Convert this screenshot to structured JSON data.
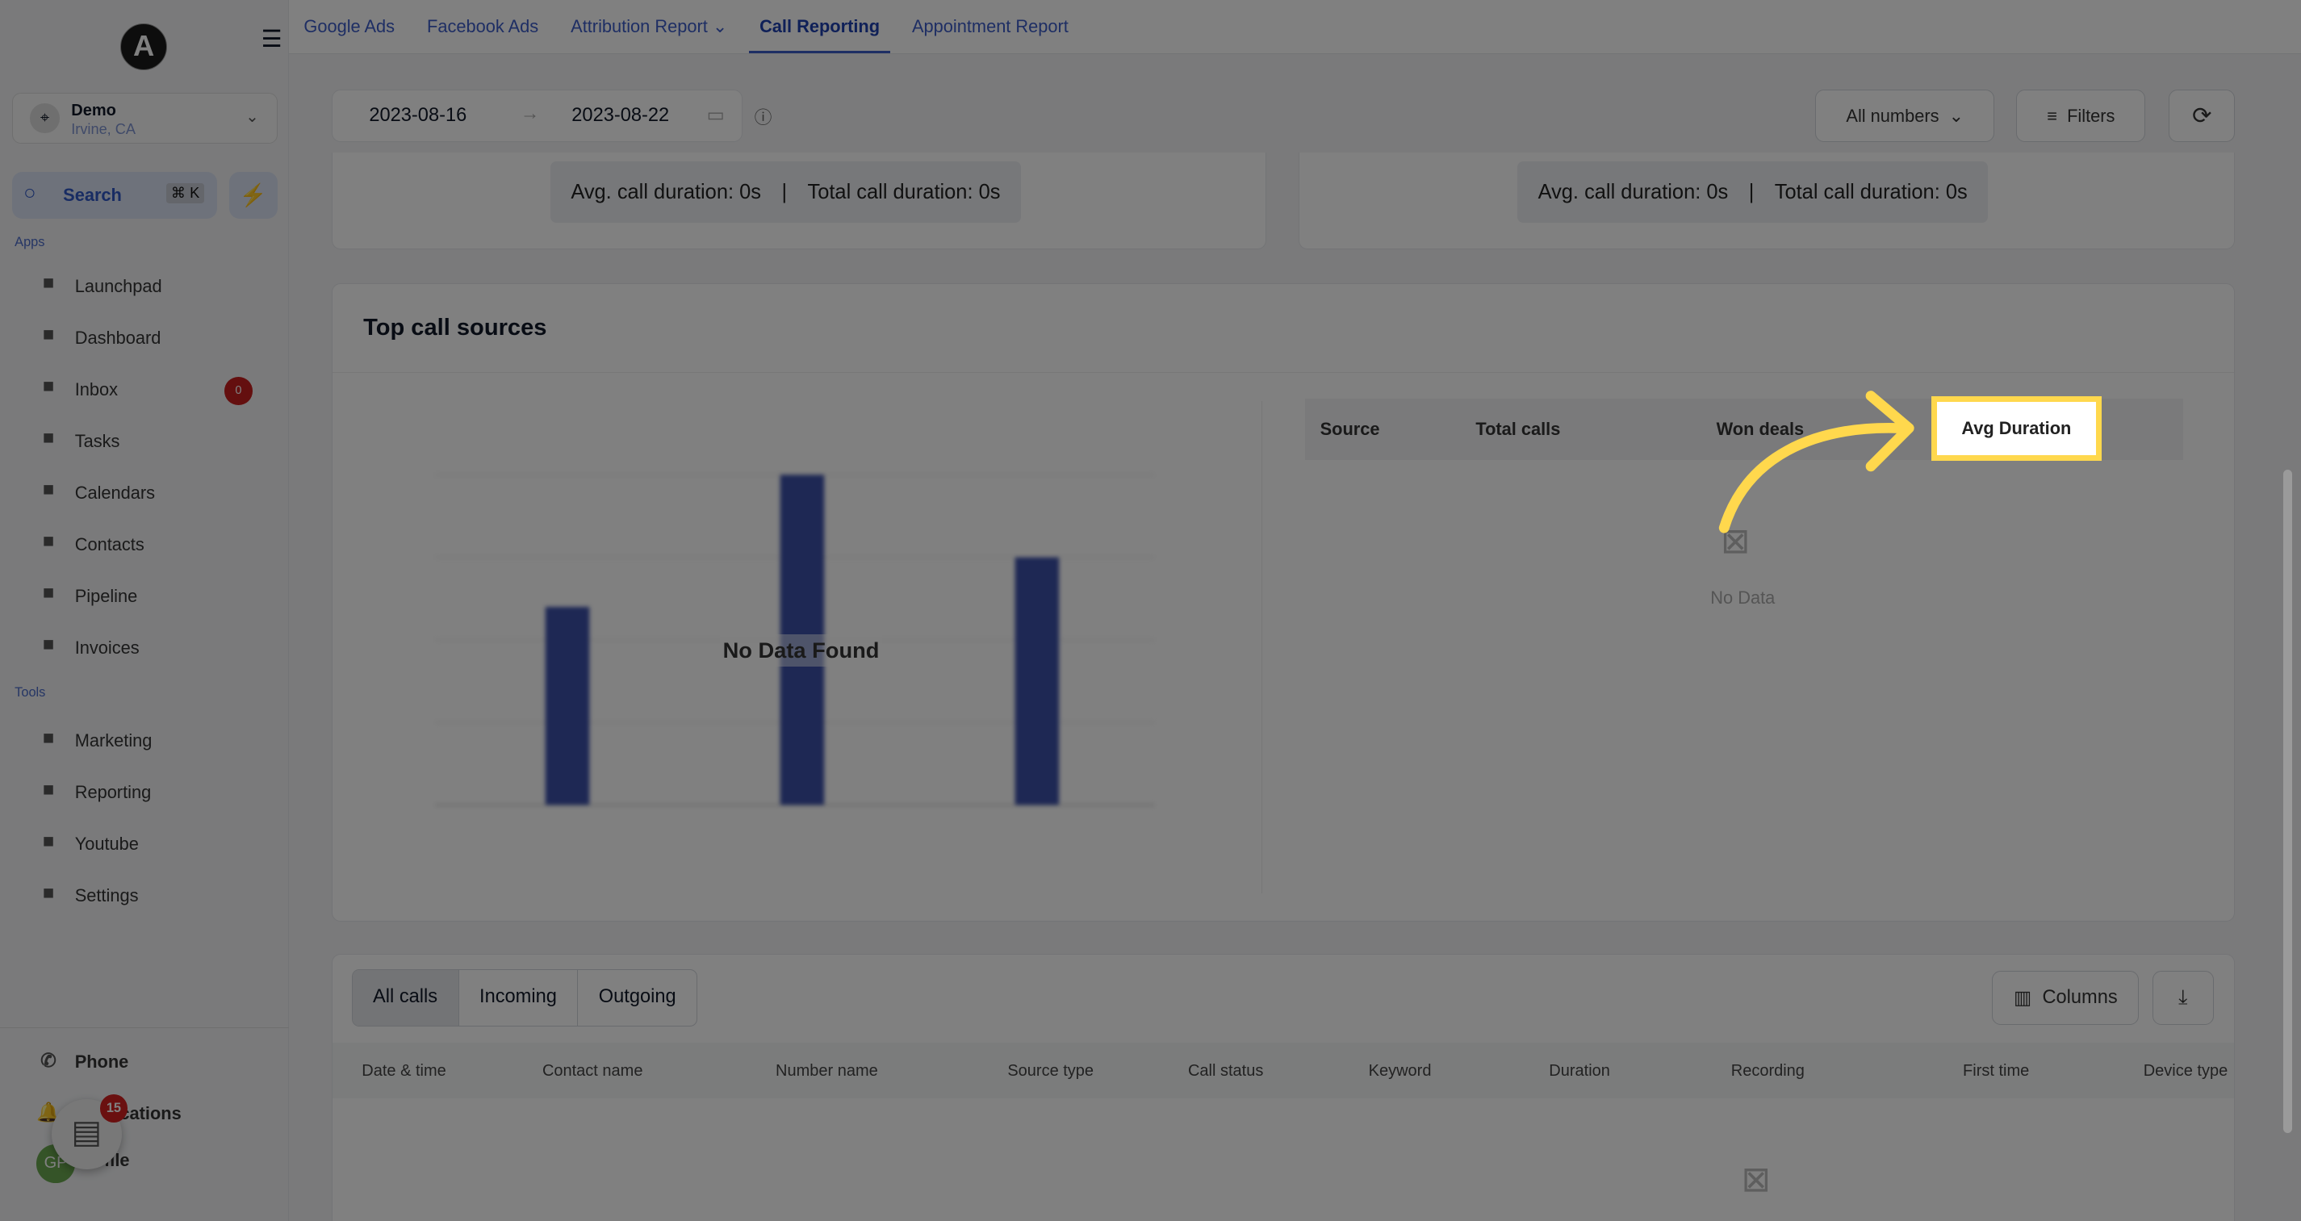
{
  "sidebar": {
    "logo_letter": "A",
    "location": {
      "name": "Demo",
      "city": "Irvine, CA"
    },
    "search": {
      "label": "Search",
      "shortcut": "⌘ K"
    },
    "apps_label": "Apps",
    "tools_label": "Tools",
    "apps": [
      {
        "label": "Launchpad",
        "icon": "rocket-icon"
      },
      {
        "label": "Dashboard",
        "icon": "grid-icon"
      },
      {
        "label": "Inbox",
        "icon": "inbox-icon",
        "badge": "0"
      },
      {
        "label": "Tasks",
        "icon": "clipboard-icon"
      },
      {
        "label": "Calendars",
        "icon": "calendar-icon"
      },
      {
        "label": "Contacts",
        "icon": "person-icon"
      },
      {
        "label": "Pipeline",
        "icon": "filter-icon"
      },
      {
        "label": "Invoices",
        "icon": "invoice-icon"
      }
    ],
    "tools": [
      {
        "label": "Marketing",
        "icon": "megaphone-icon"
      },
      {
        "label": "Reporting",
        "icon": "pie-chart-icon"
      },
      {
        "label": "Youtube",
        "icon": "video-icon"
      },
      {
        "label": "Settings",
        "icon": "gear-icon"
      }
    ],
    "bottom": {
      "phone": "Phone",
      "notifications": "Notifications",
      "profile": "Profile",
      "avatar_initials": "GP",
      "chat_badge": "15"
    }
  },
  "topnav": {
    "tabs": [
      {
        "label": "Google Ads"
      },
      {
        "label": "Facebook Ads"
      },
      {
        "label": "Attribution Report ⌄"
      },
      {
        "label": "Call Reporting",
        "active": true
      },
      {
        "label": "Appointment Report"
      }
    ]
  },
  "toolbar": {
    "start_date": "2023-08-16",
    "end_date": "2023-08-22",
    "numbers_select": "All numbers",
    "filters": "Filters"
  },
  "stats": [
    {
      "avg": "Avg. call duration: 0s",
      "total": "Total call duration: 0s"
    },
    {
      "avg": "Avg. call duration: 0s",
      "total": "Total call duration: 0s"
    }
  ],
  "top_sources": {
    "title": "Top call sources",
    "no_data_chart": "No Data Found",
    "columns": [
      "Source",
      "Total calls",
      "Won deals",
      "Avg Duration"
    ],
    "no_data": "No Data"
  },
  "chart_data": {
    "type": "bar",
    "categories": [
      "",
      "",
      ""
    ],
    "values": [
      60,
      100,
      75
    ],
    "title": "",
    "xlabel": "",
    "ylabel": "",
    "placeholder": true,
    "color": "#3b4fa8"
  },
  "calls": {
    "tabs": [
      "All calls",
      "Incoming",
      "Outgoing"
    ],
    "columns_button": "Columns",
    "headers": [
      "Date & time",
      "Contact name",
      "Number name",
      "Source type",
      "Call status",
      "Keyword",
      "Duration",
      "Recording",
      "First time",
      "Device type"
    ]
  },
  "colors": {
    "accent": "#3b5bc7",
    "highlight": "#ffd84d",
    "badge": "#c81e1e"
  }
}
